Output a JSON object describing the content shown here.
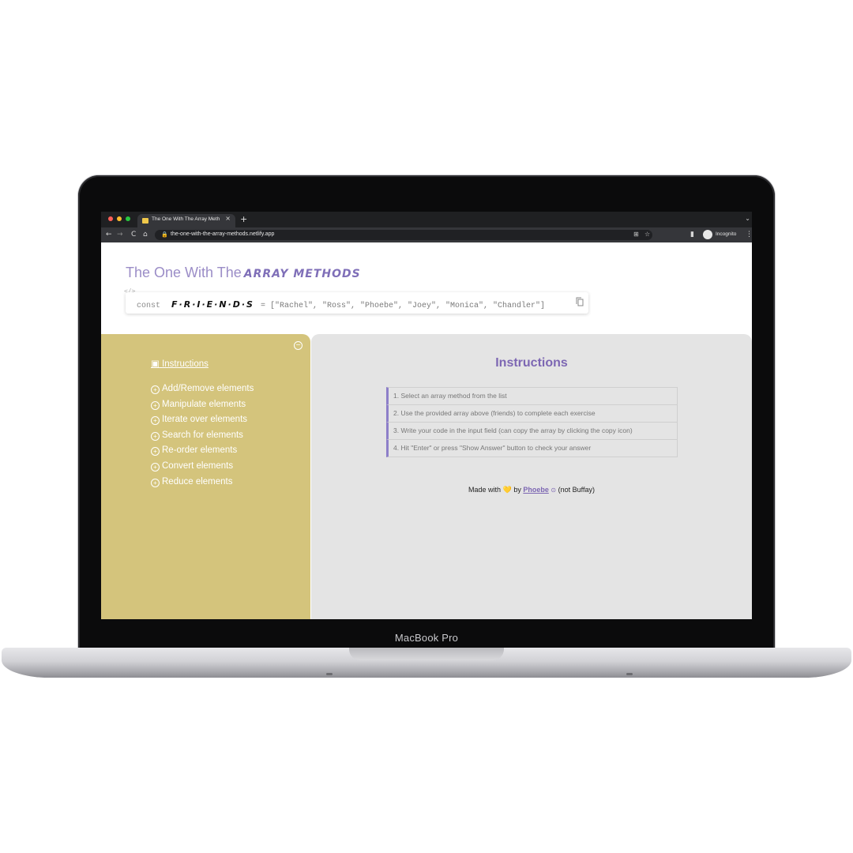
{
  "device": {
    "label": "MacBook Pro"
  },
  "browser": {
    "tab": {
      "title": "The One With The Array Meth",
      "close_glyph": "×"
    },
    "new_tab_glyph": "+",
    "url": "the-one-with-the-array-methods.netlify.app",
    "profile": "Incognito",
    "nav": {
      "back": "←",
      "forward": "→",
      "reload": "C",
      "home": "⌂"
    },
    "traffic_lights": [
      "#ff5f57",
      "#febc2e",
      "#28c840"
    ]
  },
  "page": {
    "title_plain": "The One With The",
    "title_emph": "Array methods",
    "code_tag": "</>",
    "code": {
      "keyword": "const",
      "identifier": "F·R·I·E·N·D·S",
      "rest": "= [\"Rachel\", \"Ross\", \"Phoebe\", \"Joey\", \"Monica\", \"Chandler\"]"
    },
    "sidebar": {
      "collapse_glyph": "−",
      "heading": "Instructions",
      "items": [
        {
          "icon": "+",
          "label": "Add/Remove elements"
        },
        {
          "icon": "+",
          "label": "Manipulate elements"
        },
        {
          "icon": "+",
          "label": "Iterate over elements"
        },
        {
          "icon": "+",
          "label": "Search for elements"
        },
        {
          "icon": "+",
          "label": "Re-order elements"
        },
        {
          "icon": "+",
          "label": "Convert elements"
        },
        {
          "icon": "+",
          "label": "Reduce elements"
        }
      ]
    },
    "main": {
      "heading": "Instructions",
      "steps": [
        "1. Select an array method from the list",
        "2. Use the provided array above (friends) to complete each exercise",
        "3. Write your code in the input field (can copy the array by clicking the copy icon)",
        "4. Hit \"Enter\" or press \"Show Answer\" button to check your answer"
      ],
      "footer": {
        "prefix": "Made with",
        "heart": "💛",
        "by": "by",
        "author": "Phoebe",
        "suffix": "(not Buffay)"
      }
    },
    "colors": {
      "sidebar": "#d4c47c",
      "accent": "#7d67b3",
      "panel": "#e4e4e4"
    }
  }
}
